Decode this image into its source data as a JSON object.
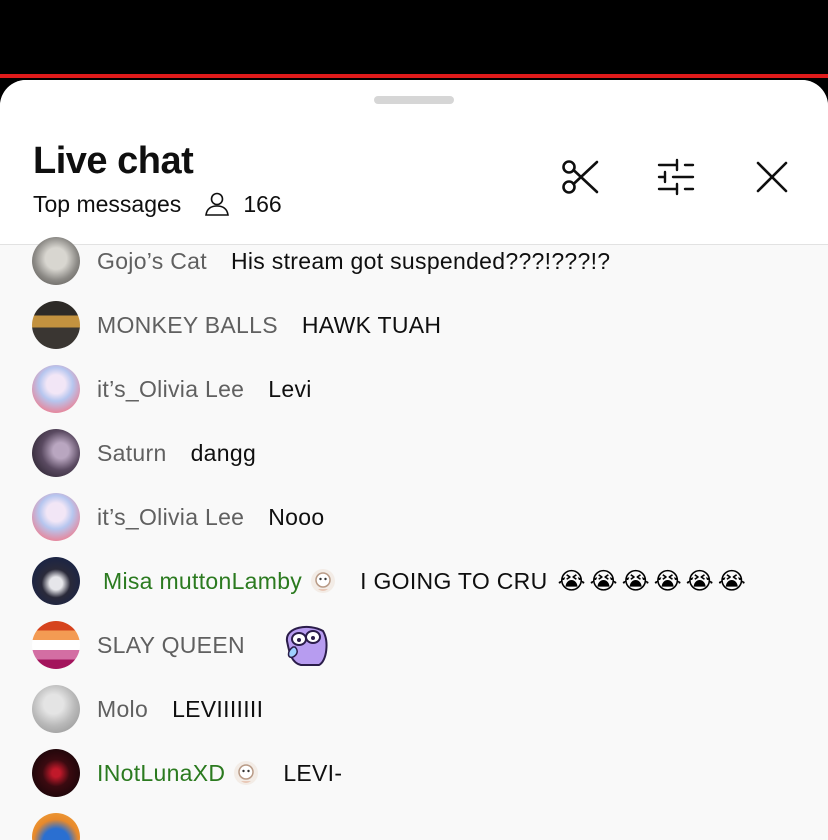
{
  "header": {
    "title": "Live chat",
    "mode_label": "Top messages",
    "viewer_count": "166"
  },
  "colors": {
    "accent_red": "#e01b1b",
    "member_green": "#2b7a1f",
    "author_gray": "#606060"
  },
  "icons": {
    "clip": "scissors-icon",
    "filter": "sliders-icon",
    "close": "close-icon",
    "viewers": "person-icon"
  },
  "messages": [
    {
      "author": "Gojo’s Cat",
      "text": "His stream got suspended???!???!?"
    },
    {
      "author": "MONKEY BALLS",
      "text": "HAWK TUAH"
    },
    {
      "author": "it’s_Olivia Lee",
      "text": "Levi"
    },
    {
      "author": "Saturn",
      "text": "dangg"
    },
    {
      "author": "it’s_Olivia Lee",
      "text": "Nooo"
    },
    {
      "author": "Misa muttonLamby",
      "text": "I GOING TO CRU",
      "emoji": [
        "😭",
        "😭",
        "😭",
        "😭",
        "😭",
        "😭"
      ]
    },
    {
      "author": "SLAY QUEEN",
      "text": ""
    },
    {
      "author": "Molo",
      "text": "LEVIIIIIII"
    },
    {
      "author": "INotLunaXD",
      "text": "LEVI-"
    }
  ]
}
